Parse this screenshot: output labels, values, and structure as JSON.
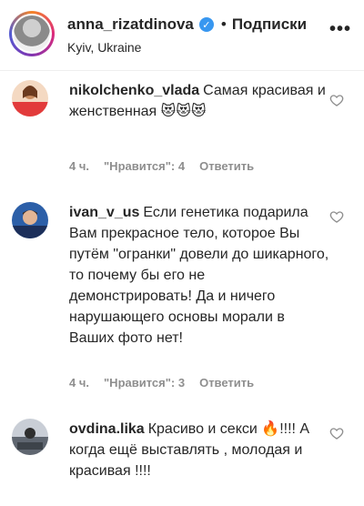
{
  "header": {
    "username": "anna_rizatdinova",
    "verified_glyph": "✓",
    "dot": "•",
    "follow_label": "Подписки",
    "location": "Kyiv, Ukraine",
    "more_icon": "•••"
  },
  "comments": [
    {
      "username": "nikolchenko_vlada",
      "text": "Самая красивая и женственная",
      "emojis": "😻😻😻",
      "time": "4 ч.",
      "likes": "\"Нравится\": 4",
      "reply": "Ответить"
    },
    {
      "username": "ivan_v_us",
      "text": "Если генетика подарила Вам прекрасное тело, которое Вы путём \"огранки\" довели до шикарного, то почему бы его не демонстрировать! Да и ничего нарушающего основы морали в Ваших фото нет!",
      "time": "4 ч.",
      "likes": "\"Нравится\": 3",
      "reply": "Ответить"
    },
    {
      "username": "ovdina.lika",
      "text_before": "Красиво и секси",
      "fire": "🔥",
      "text_after": "!!!! А когда ещё выставлять , молодая и красивая !!!!"
    }
  ]
}
